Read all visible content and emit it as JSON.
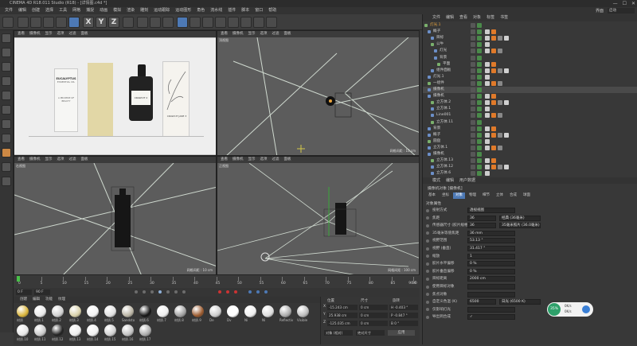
{
  "window": {
    "title": "CINEMA 4D R18.011 Studio (R18) - [详情图.c4d *]",
    "controls": [
      "—",
      "☐",
      "✕"
    ]
  },
  "menu": [
    "文件",
    "编辑",
    "创建",
    "选择",
    "工具",
    "网格",
    "捕捉",
    "动画",
    "模拟",
    "渲染",
    "雕刻",
    "运动跟踪",
    "运动图形",
    "角色",
    "流水线",
    "插件",
    "脚本",
    "窗口",
    "帮助"
  ],
  "interface_label": "界面",
  "interface_value": "启动",
  "toolbar": {
    "x": "X",
    "y": "Y",
    "z": "Z"
  },
  "viewports": {
    "top_left": {
      "menu": [
        "查看",
        "摄像机",
        "显示",
        "选项",
        "过滤",
        "面板"
      ],
      "label": "透视视图",
      "boxes": {
        "box1": "EUCALYPTUS",
        "box1_sub": "ESSENTIAL OIL",
        "box2": "A PROMISE OF BEAUTY",
        "bottle": "CRAWCIT 2",
        "box3": "CRAWCIT JANE 3"
      }
    },
    "top_right": {
      "menu": [
        "查看",
        "摄像机",
        "显示",
        "选项",
        "过滤",
        "面板"
      ],
      "label": "顶视图",
      "footer": "网格间距 : 10 cm"
    },
    "bottom_left": {
      "menu": [
        "查看",
        "摄像机",
        "显示",
        "选项",
        "过滤",
        "面板"
      ],
      "label": "右视图",
      "footer": "网格间距 : 10 cm"
    },
    "bottom_right": {
      "menu": [
        "查看",
        "摄像机",
        "显示",
        "选项",
        "过滤",
        "面板"
      ],
      "label": "正视图",
      "footer": "网格间距 : 100 cm"
    }
  },
  "timeline": {
    "ticks": [
      "0",
      "5",
      "10",
      "15",
      "20",
      "25",
      "30",
      "35",
      "40",
      "45",
      "50",
      "55",
      "60",
      "65",
      "70",
      "75",
      "80",
      "85",
      "90"
    ],
    "frame": "0 F",
    "start": "0 F",
    "end": "90 F",
    "current": "90 F"
  },
  "materials": {
    "menu": [
      "创建",
      "编辑",
      "功能",
      "纹理"
    ],
    "items": [
      "材质",
      "材质.1",
      "材质.2",
      "材质.3",
      "材质.4",
      "材质.5",
      "Sandsto",
      "材质.6",
      "材质.7",
      "材质.8",
      "材质.9",
      "De",
      "Dv",
      "Ni",
      "Ni",
      "Reflectiv",
      "Visible",
      "材质.10",
      "材质.11",
      "材质.12",
      "材质.13",
      "材质.14",
      "材质.15",
      "材质.16",
      "材质.17"
    ]
  },
  "coords": {
    "headers": [
      "位置",
      "尺寸",
      "旋转"
    ],
    "rows": [
      {
        "axis": "X",
        "pos": "-15.243 cm",
        "size": "0 cm",
        "rot": "H  -0.403 °"
      },
      {
        "axis": "Y",
        "pos": "25.938 cm",
        "size": "0 cm",
        "rot": "P  -0.847 °"
      },
      {
        "axis": "Z",
        "pos": "-125.035 cm",
        "size": "0 cm",
        "rot": "B  0 °"
      }
    ],
    "mode": "对象 (相对)",
    "size_mode": "绝对尺寸",
    "apply": "应用"
  },
  "objects": {
    "menu": [
      "文件",
      "编辑",
      "查看",
      "对象",
      "标签",
      "书签"
    ],
    "rows": [
      "灯光.1",
      "概子",
      "目标",
      "公牛",
      "灯光",
      "背景",
      "平面",
      "组件面板",
      "灯光.1",
      "一组件",
      "摄像机",
      "摄像机",
      "立方体.2",
      "立方体.1",
      "Line001",
      "立方体.11",
      "背景",
      "概子",
      "圆盘",
      "立方体.1",
      "摄像机",
      "立方体.13",
      "立方体.12",
      "立方体.6"
    ]
  },
  "attributes": {
    "menu": [
      "模式",
      "编辑",
      "用户数据"
    ],
    "title": "摄像机对象 [摄像机]",
    "tabs": [
      "基本",
      "坐标",
      "对象",
      "物理",
      "细节",
      "立体",
      "合成",
      "球面"
    ],
    "section": "对象属性",
    "rows": [
      {
        "label": "投射方式",
        "value": "透视视图"
      },
      {
        "label": "焦距",
        "value": "36",
        "extra": "经典 (36毫米)"
      },
      {
        "label": "传感器尺寸 (胶片规格)",
        "value": "36",
        "extra": "35毫米照片 (36.0毫米)"
      },
      {
        "label": "35毫米等值焦距",
        "value": "36 mm"
      },
      {
        "label": "视野范围",
        "value": "53.13 °"
      },
      {
        "label": "视野 (垂直)",
        "value": "31.417 °"
      },
      {
        "label": "缩放",
        "value": "1"
      },
      {
        "label": "胶片水平偏移",
        "value": "0 %"
      },
      {
        "label": "胶片垂直偏移",
        "value": "0 %"
      },
      {
        "label": "目标距离",
        "value": "2000 cm"
      },
      {
        "label": "使用目标对象",
        "value": ""
      },
      {
        "label": "焦点对象",
        "value": ""
      },
      {
        "label": "自定义色温 (K)",
        "value": "6500",
        "extra": "日光 (6500 K)"
      },
      {
        "label": "仅影响灯光",
        "value": ""
      },
      {
        "label": "导出到合成",
        "value": "✓"
      }
    ]
  },
  "badge": {
    "percent": "35%",
    "up": "0K/s",
    "down": "0K/s"
  },
  "colors": {
    "accent": "#e7a33e",
    "select": "#4d79b5",
    "green": "#2ea06a"
  }
}
